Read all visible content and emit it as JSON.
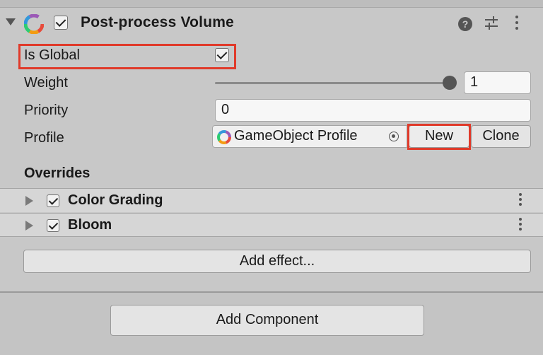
{
  "component": {
    "title": "Post-process Volume",
    "enabled": true,
    "icons": {
      "foldout": "foldout-expanded-icon",
      "component": "post-process-icon",
      "help": "help-icon",
      "presets": "presets-icon",
      "menu": "kebab-menu-icon"
    }
  },
  "fields": {
    "is_global": {
      "label": "Is Global",
      "checked": true
    },
    "weight": {
      "label": "Weight",
      "value": "1",
      "slider_fraction": 1.0
    },
    "priority": {
      "label": "Priority",
      "value": "0"
    },
    "profile": {
      "label": "Profile",
      "value": "GameObject Profile",
      "new_label": "New",
      "clone_label": "Clone"
    }
  },
  "overrides": {
    "heading": "Overrides",
    "effects": [
      {
        "name": "Color Grading",
        "enabled": true
      },
      {
        "name": "Bloom",
        "enabled": true
      }
    ],
    "add_effect_label": "Add effect..."
  },
  "inspector": {
    "add_component_label": "Add Component"
  },
  "colors": {
    "highlight": "#e03a2a",
    "background": "#c8c8c8"
  }
}
